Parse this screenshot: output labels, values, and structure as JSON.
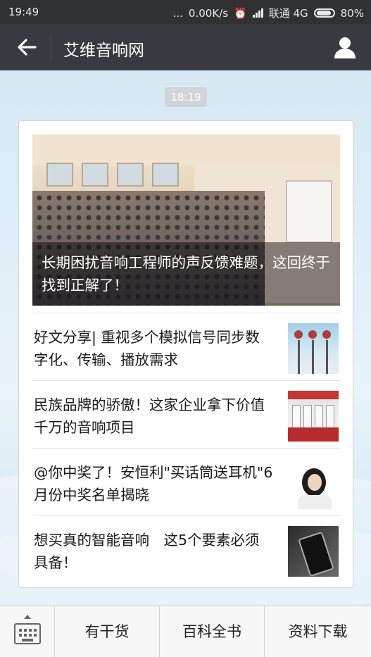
{
  "status_bar": {
    "time": "19:49",
    "dots": "...",
    "speed": "0.00K/s",
    "carrier": "联通 4G",
    "battery": "80%"
  },
  "header": {
    "title": "艾维音响网",
    "back_icon": "arrow-left-icon",
    "profile_icon": "person-icon"
  },
  "chat": {
    "timestamp": "18:19"
  },
  "article_card": {
    "hero_title": "长期困扰音响工程师的声反馈难题，这回终于找到正解了！",
    "items": [
      {
        "title": "好文分享| 重视多个模拟信号同步数字化、传输、播放需求"
      },
      {
        "title": "民族品牌的骄傲！这家企业拿下价值千万的音响项目"
      },
      {
        "title": "@你中奖了！安恒利\"买话筒送耳机\"6月份中奖名单揭晓"
      },
      {
        "title": "想买真的智能音响　这5个要素必须具备！"
      }
    ]
  },
  "bottom_menu": {
    "keyboard_icon": "keyboard-icon",
    "items": [
      "有干货",
      "百科全书",
      "资料下载"
    ]
  }
}
